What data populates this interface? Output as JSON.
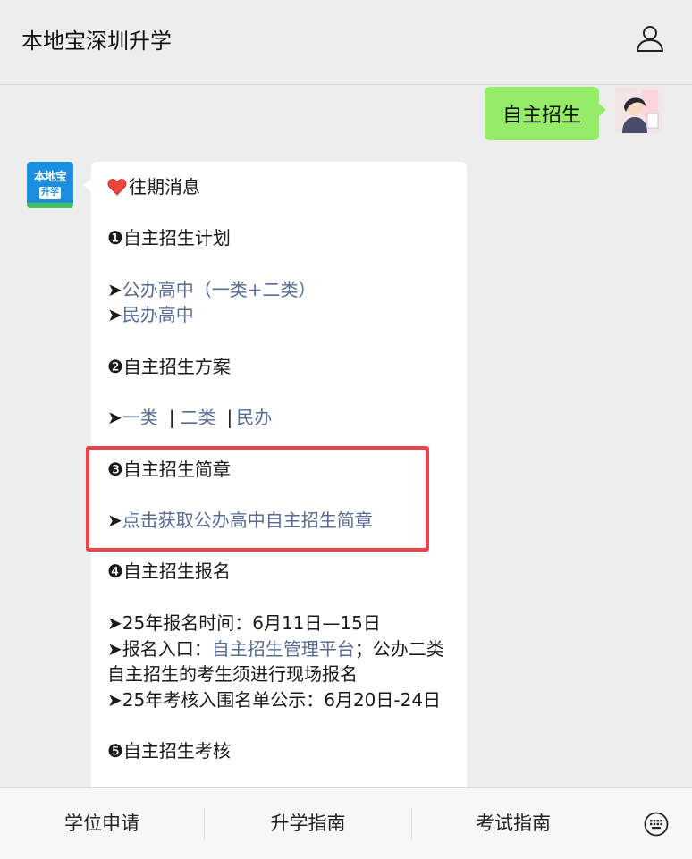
{
  "header": {
    "title": "本地宝深圳升学"
  },
  "sent_message": {
    "text": "自主招生"
  },
  "bot_avatar": {
    "logo_top": "本地宝",
    "logo_bottom": "升学"
  },
  "message": {
    "heading": "往期消息",
    "s1_title": "❶自主招生计划",
    "s1_links": [
      "公办高中（一类+二类）",
      "民办高中"
    ],
    "s2_title": "❷自主招生方案",
    "s2_links": [
      "一类",
      "二类",
      "民办"
    ],
    "s2_sep": "|",
    "arrow": "➤",
    "s3_title": "❸自主招生简章",
    "s3_link": "点击获取公办高中自主招生简章",
    "s4_title": "❹自主招生报名",
    "s4_time": "25年报名时间：6月11日—15日",
    "s4_entry_prefix": "报名入口：",
    "s4_entry_link": "自主招生管理平台",
    "s4_entry_suffix": "；公办二类自主招生的考生须进行现场报名",
    "s4_publicity": "25年考核入围名单公示：6月20日-24日",
    "s5_title": "❺自主招生考核"
  },
  "menu": {
    "items": [
      "学位申请",
      "升学指南",
      "考试指南"
    ]
  },
  "colors": {
    "background": "#ededed",
    "sent_bubble": "#95ec69",
    "link": "#576b95",
    "highlight": "#e8454d",
    "heart": "#e8453c"
  }
}
